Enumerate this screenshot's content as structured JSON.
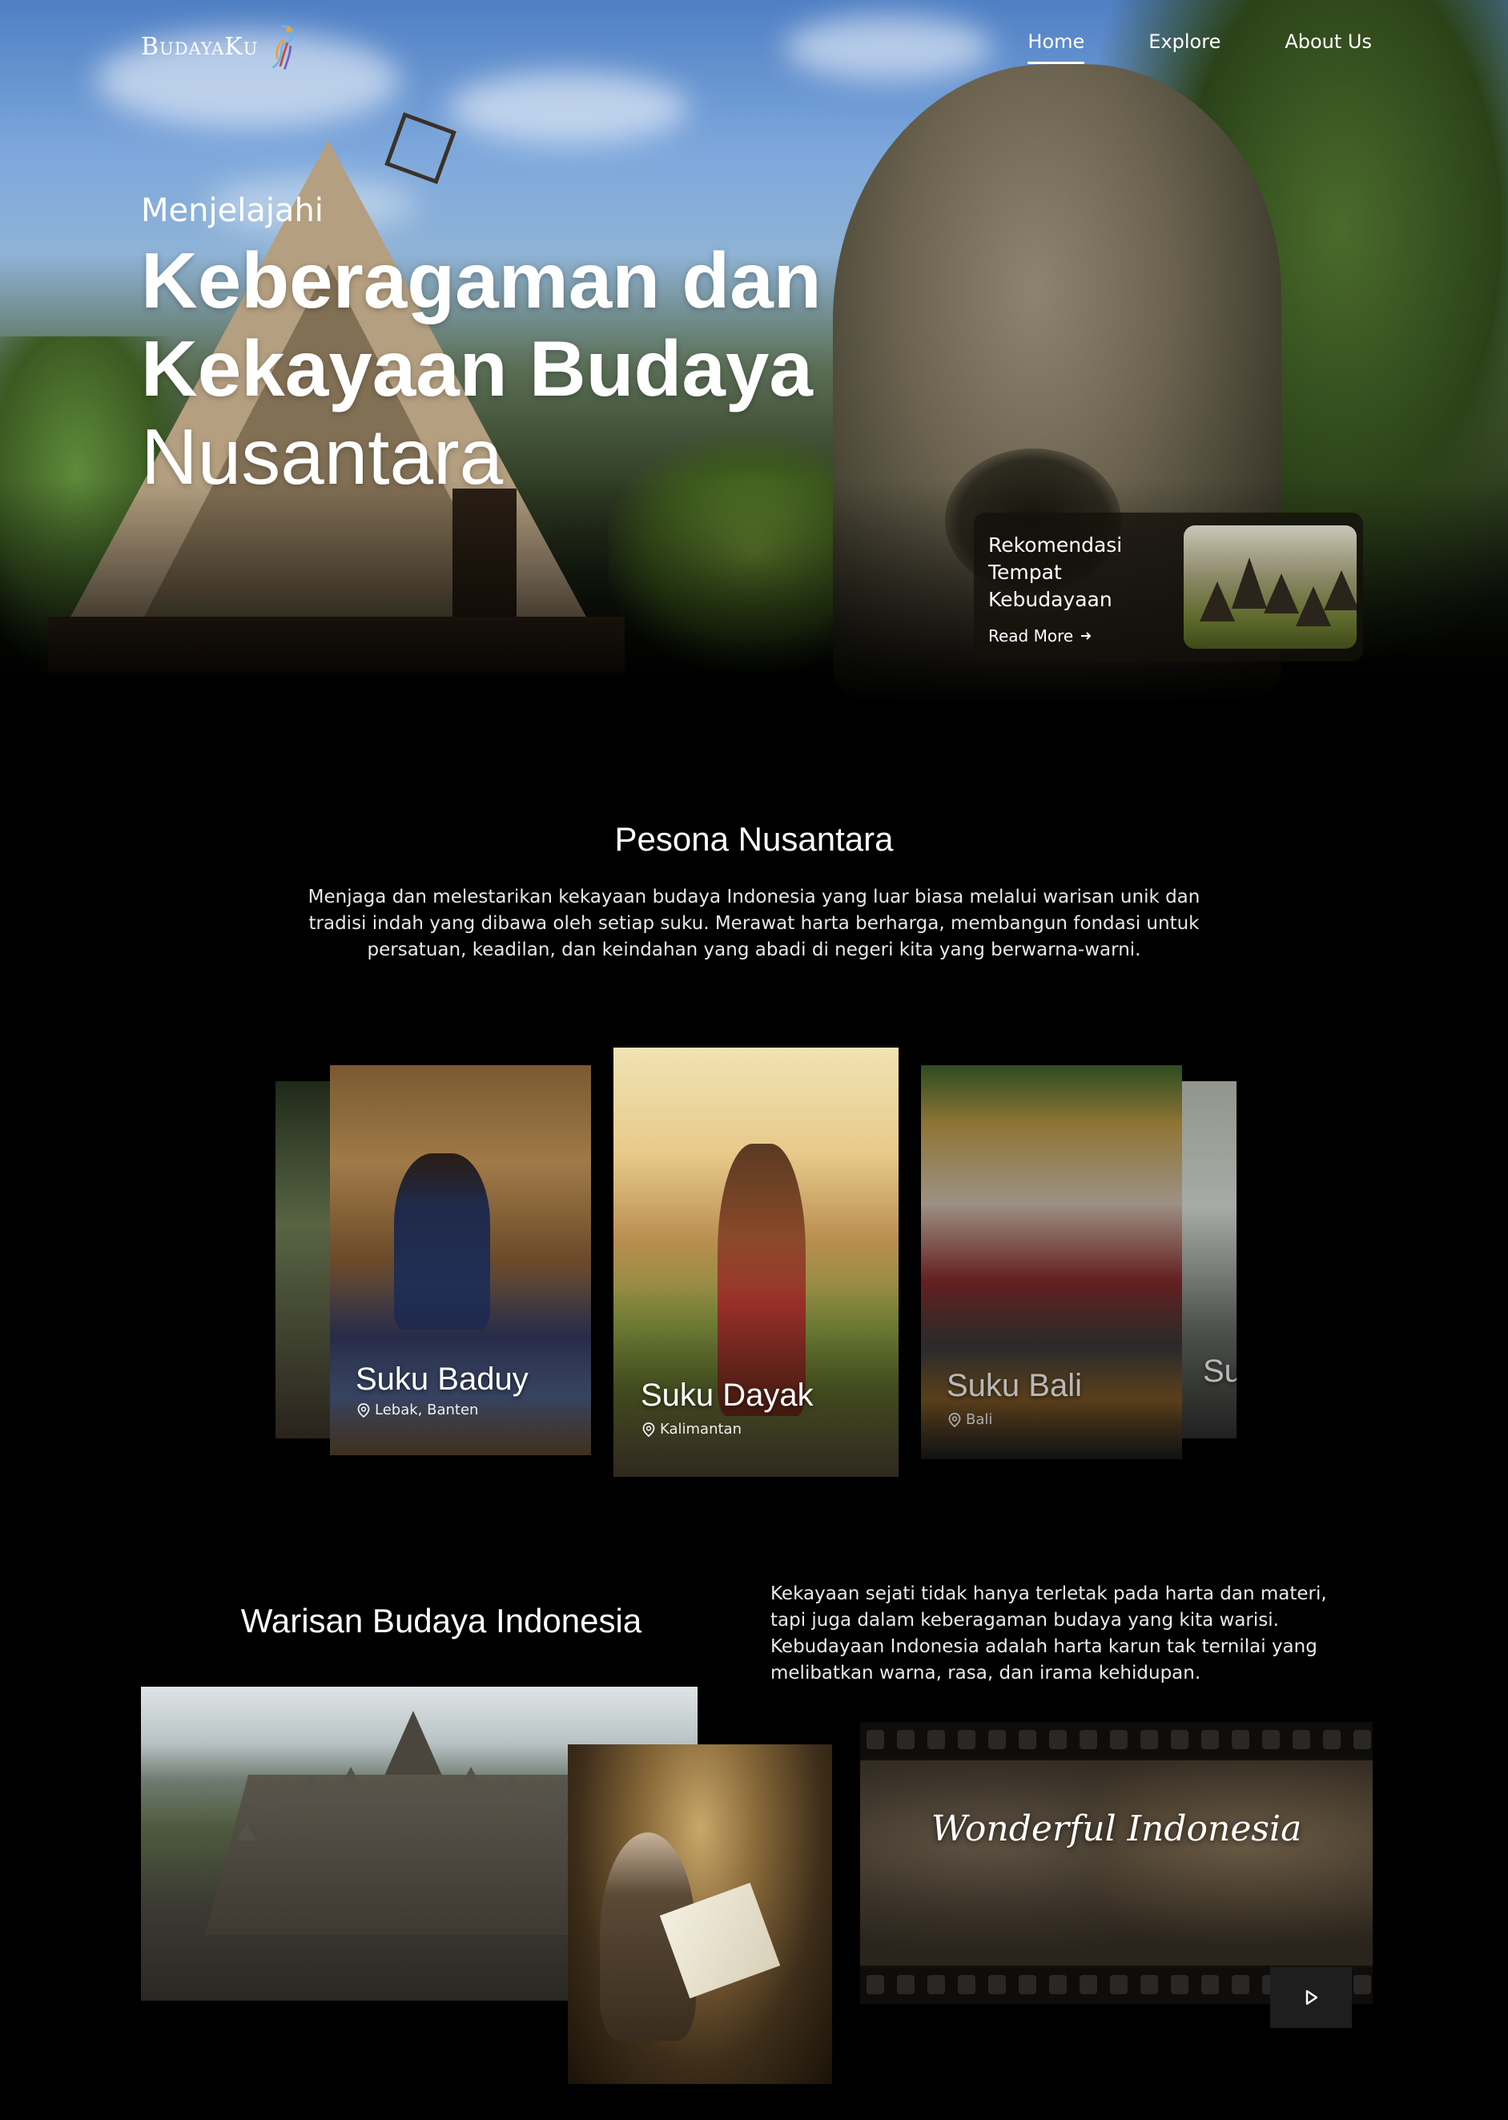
{
  "nav": {
    "logo_text": "BudayaKu",
    "items": [
      {
        "label": "Home",
        "active": true
      },
      {
        "label": "Explore",
        "active": false
      },
      {
        "label": "About Us",
        "active": false
      }
    ]
  },
  "hero": {
    "pre_title": "Menjelajahi",
    "title_line1": "Keberagaman dan",
    "title_line2": "Kekayaan Budaya",
    "title_line3": "Nusantara",
    "recommend": {
      "title": "Rekomendasi Tempat Kebudayaan",
      "link": "Read More",
      "link_icon": "arrow-right-icon"
    }
  },
  "pesona": {
    "title": "Pesona Nusantara",
    "description": "Menjaga dan melestarikan kekayaan budaya Indonesia yang luar biasa melalui warisan unik dan tradisi indah yang dibawa oleh setiap suku. Merawat harta berharga, membangun fondasi untuk persatuan, keadilan, dan keindahan yang abadi di negeri kita yang berwarna-warni.",
    "cards": [
      {
        "name": "Suku Baduy",
        "location": "Lebak, Banten"
      },
      {
        "name": "Suku Dayak",
        "location": "Kalimantan"
      },
      {
        "name": "Suku Bali",
        "location": "Bali"
      },
      {
        "name": "Su",
        "location": ""
      }
    ]
  },
  "warisan": {
    "title": "Warisan Budaya Indonesia",
    "description": "Kekayaan sejati tidak hanya terletak pada harta dan materi, tapi juga dalam keberagaman budaya yang kita warisi. Kebudayaan Indonesia adalah harta karun tak ternilai yang melibatkan warna, rasa, dan irama kehidupan.",
    "video_title": "Wonderful Indonesia",
    "play_icon": "play-icon"
  }
}
